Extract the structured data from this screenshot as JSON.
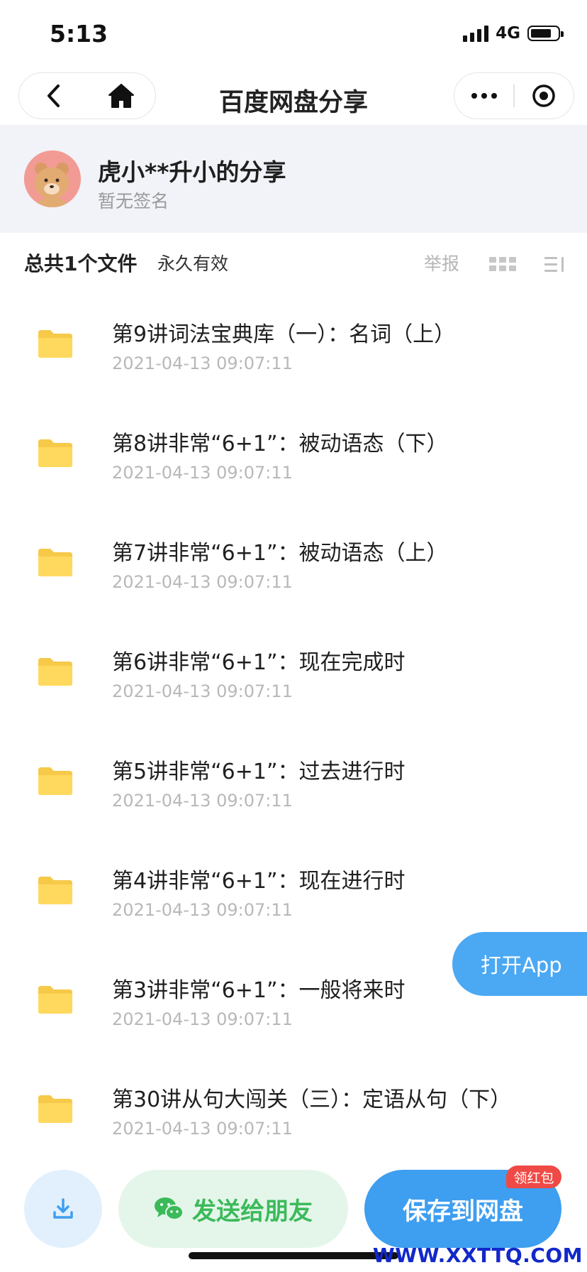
{
  "status_bar": {
    "time": "5:13",
    "network": "4G"
  },
  "nav": {
    "title": "百度网盘分享"
  },
  "sharer": {
    "name": "虎小**升小的分享",
    "signature": "暂无签名"
  },
  "summary": {
    "count": "总共1个文件",
    "validity": "永久有效",
    "report": "举报"
  },
  "files": [
    {
      "title": "第9讲词法宝典库（一）：名词（上）",
      "date": "2021-04-13 09:07:11"
    },
    {
      "title": "第8讲非常“6+1”：被动语态（下）",
      "date": "2021-04-13 09:07:11"
    },
    {
      "title": "第7讲非常“6+1”：被动语态（上）",
      "date": "2021-04-13 09:07:11"
    },
    {
      "title": "第6讲非常“6+1”：现在完成时",
      "date": "2021-04-13 09:07:11"
    },
    {
      "title": "第5讲非常“6+1”：过去进行时",
      "date": "2021-04-13 09:07:11"
    },
    {
      "title": "第4讲非常“6+1”：现在进行时",
      "date": "2021-04-13 09:07:11"
    },
    {
      "title": "第3讲非常“6+1”：一般将来时",
      "date": "2021-04-13 09:07:11"
    },
    {
      "title": "第30讲从句大闯关（三）：定语从句（下）",
      "date": "2021-04-13 09:07:11"
    }
  ],
  "float": {
    "open_app": "打开App"
  },
  "actions": {
    "send": "发送给朋友",
    "save": "保存到网盘",
    "redpack": "领红包"
  },
  "watermark": "WWW.XXTTQ.COM",
  "colors": {
    "accent": "#3e9ef0",
    "green": "#3bba5a",
    "folder": "#ffd75a",
    "badge": "#ef4a45"
  }
}
